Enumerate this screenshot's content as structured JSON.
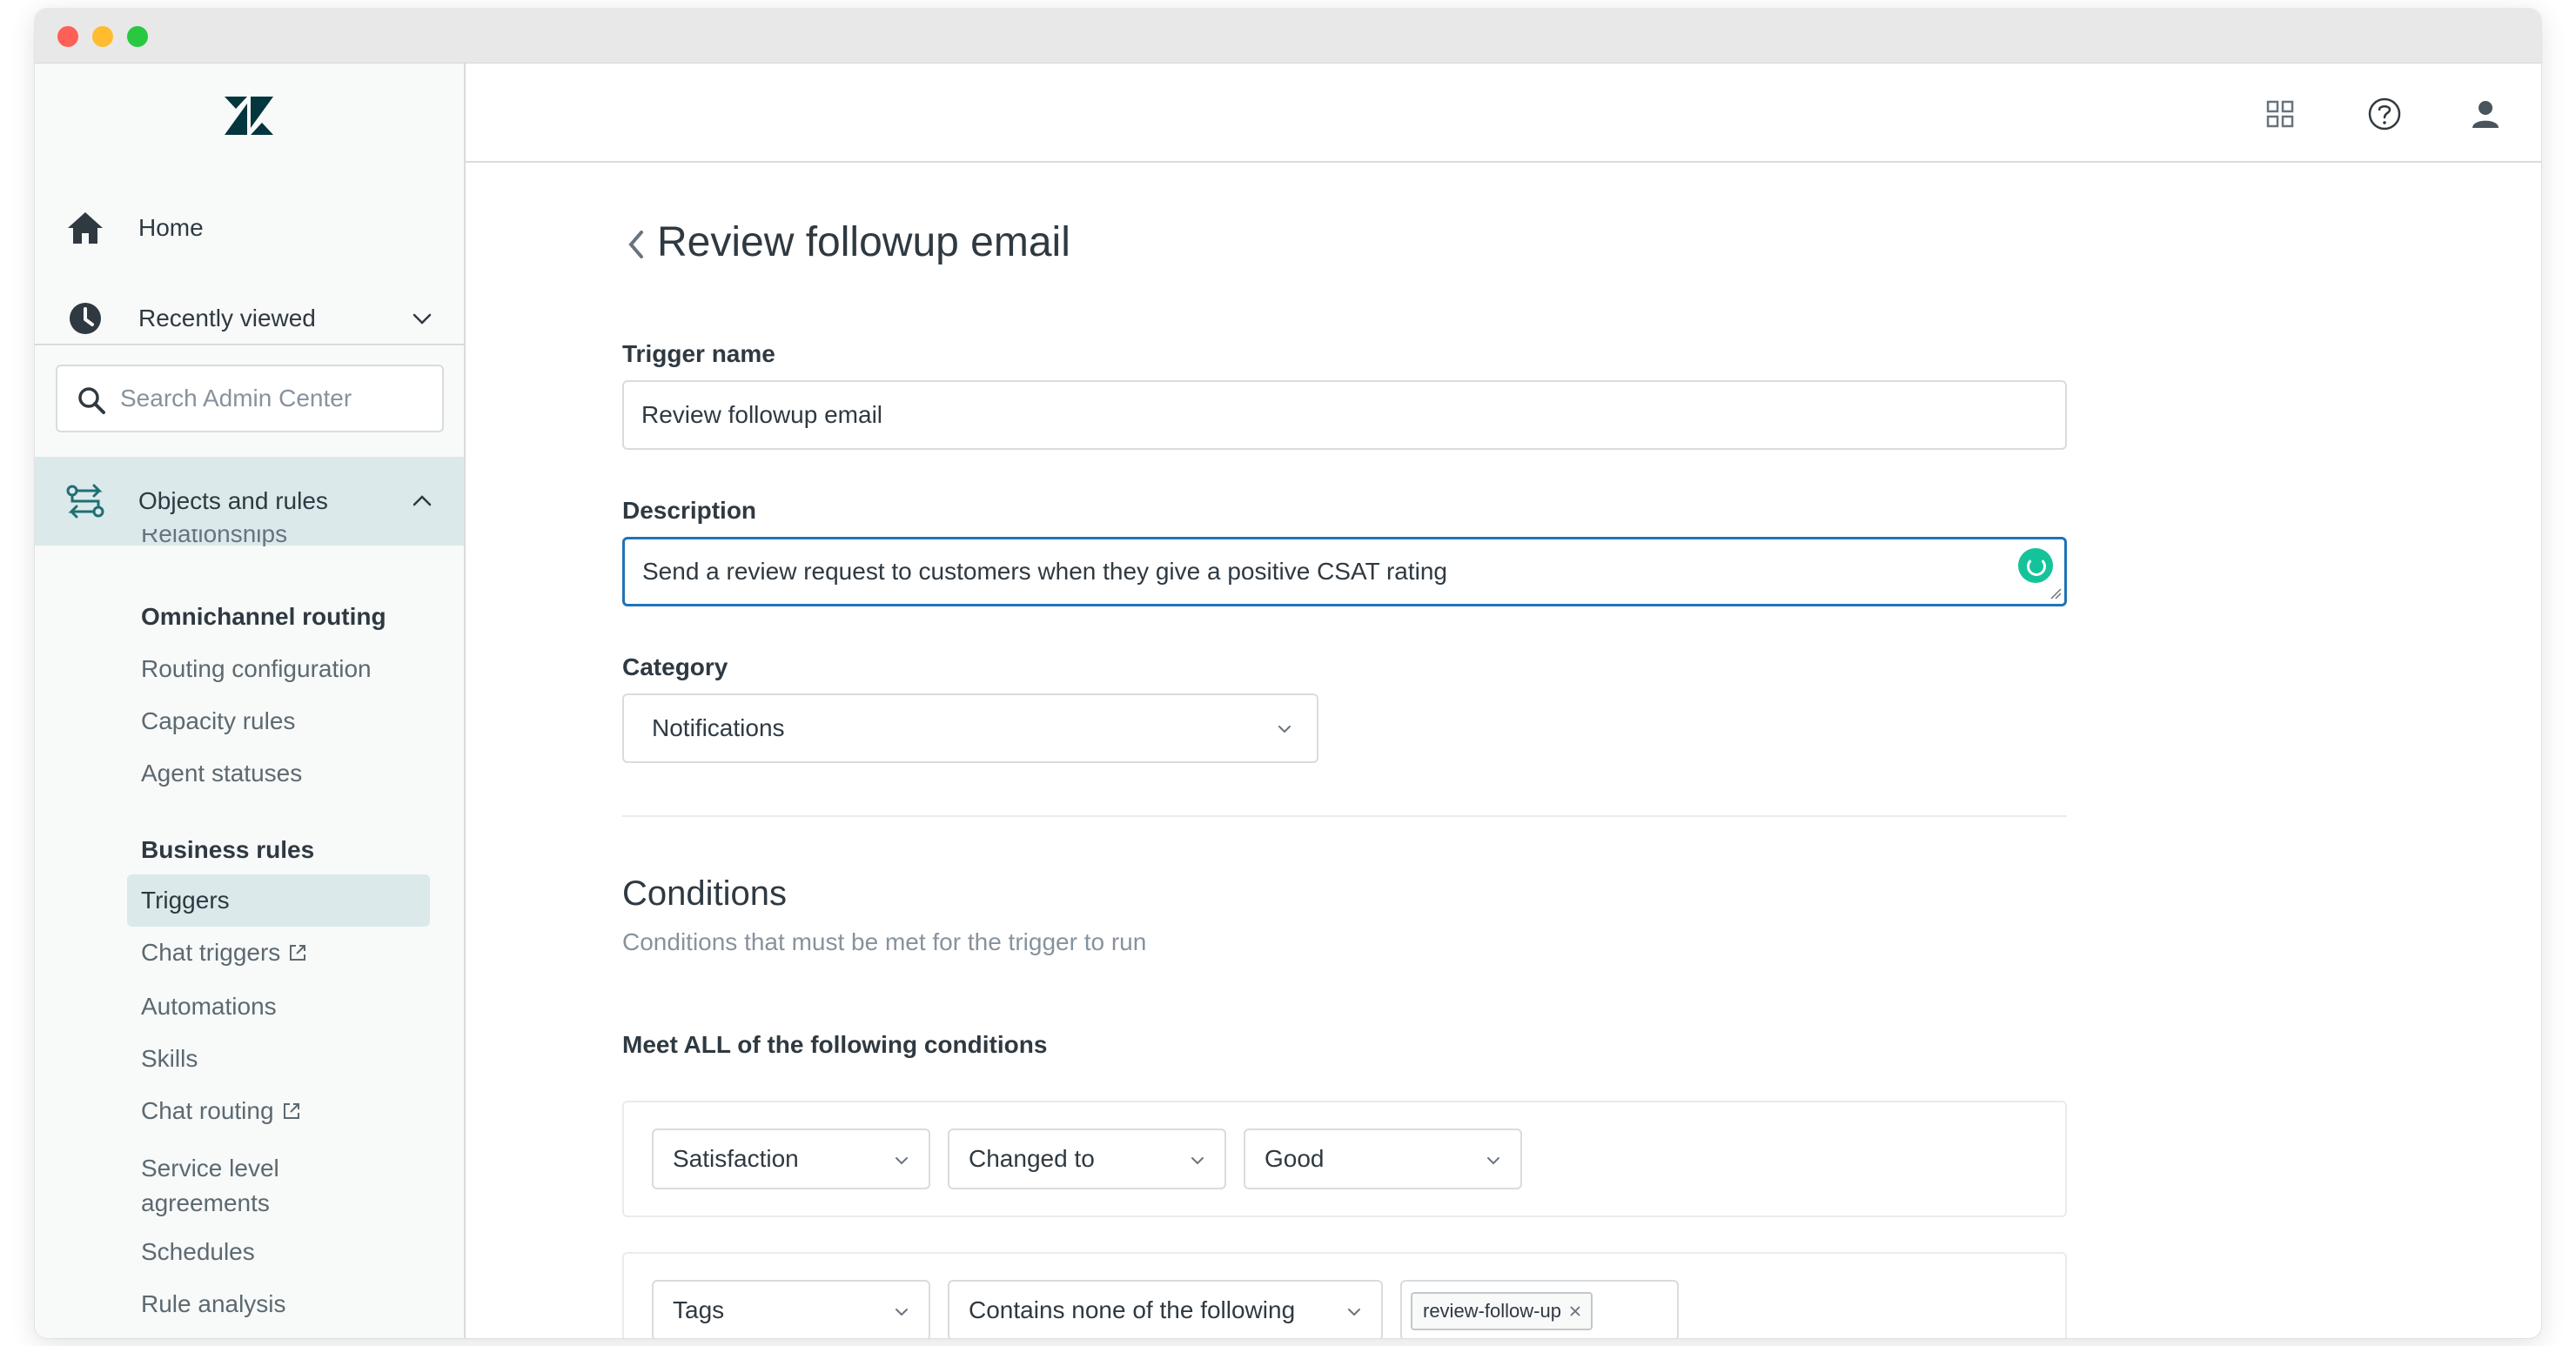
{
  "sidebar": {
    "home_label": "Home",
    "recently_viewed_label": "Recently viewed",
    "search_placeholder": "Search Admin Center",
    "objects_label": "Objects and rules",
    "cut_item_label": "Relationships",
    "omnichannel": {
      "heading": "Omnichannel routing",
      "items": [
        "Routing configuration",
        "Capacity rules",
        "Agent statuses"
      ]
    },
    "business_rules": {
      "heading": "Business rules",
      "triggers": "Triggers",
      "chat_triggers": "Chat triggers",
      "automations": "Automations",
      "skills": "Skills",
      "chat_routing": "Chat routing",
      "sla_line1": "Service level",
      "sla_line2": "agreements",
      "schedules": "Schedules",
      "rule_analysis": "Rule analysis"
    }
  },
  "header": {
    "page_title": "Review followup email"
  },
  "form": {
    "trigger_name_label": "Trigger name",
    "trigger_name_value": "Review followup email",
    "description_label": "Description",
    "description_value": "Send a review request to customers when they give a positive CSAT rating",
    "category_label": "Category",
    "category_value": "Notifications"
  },
  "conditions": {
    "title": "Conditions",
    "subtitle": "Conditions that must be met for the trigger to run",
    "meet_all_label": "Meet ALL of the following conditions",
    "rows": [
      {
        "field": "Satisfaction",
        "operator": "Changed to",
        "value": "Good"
      },
      {
        "field": "Tags",
        "operator": "Contains none of the following",
        "tag": "review-follow-up"
      }
    ]
  },
  "colors": {
    "accent": "#1f73b7",
    "sidebar_active": "#dbe9ea",
    "grammarly": "#15c39a"
  }
}
